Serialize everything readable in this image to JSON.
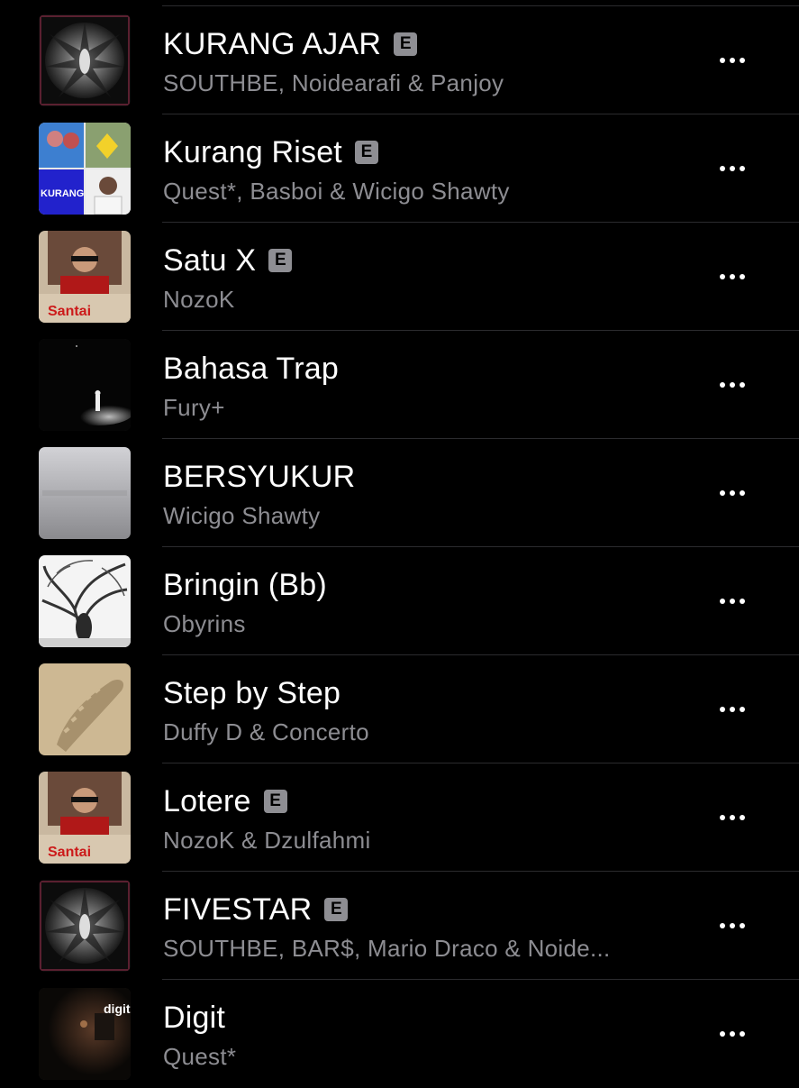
{
  "songs": [
    {
      "title": "KURANG AJAR",
      "explicit": true,
      "explicit_label": "E",
      "artist": "SOUTHBE, Noidearafi & Panjoy",
      "artwork": "symmetric-dark-art"
    },
    {
      "title": "Kurang Riset",
      "explicit": true,
      "explicit_label": "E",
      "artist": "Quest*, Basboi & Wicigo Shawty",
      "artwork": "collage-art"
    },
    {
      "title": "Satu X",
      "explicit": true,
      "explicit_label": "E",
      "artist": "NozoK",
      "artwork": "portrait-red-art"
    },
    {
      "title": "Bahasa Trap",
      "explicit": false,
      "explicit_label": "",
      "artist": "Fury+",
      "artwork": "spotlight-figure-art"
    },
    {
      "title": "BERSYUKUR",
      "explicit": false,
      "explicit_label": "",
      "artist": "Wicigo Shawty",
      "artwork": "grey-gradient-art"
    },
    {
      "title": "Bringin (Bb)",
      "explicit": false,
      "explicit_label": "",
      "artist": "Obyrins",
      "artwork": "tree-sketch-art"
    },
    {
      "title": "Step by Step",
      "explicit": false,
      "explicit_label": "",
      "artist": "Duffy D & Concerto",
      "artwork": "footprint-sand-art"
    },
    {
      "title": "Lotere",
      "explicit": true,
      "explicit_label": "E",
      "artist": "NozoK & Dzulfahmi",
      "artwork": "portrait-red-art"
    },
    {
      "title": "FIVESTAR",
      "explicit": true,
      "explicit_label": "E",
      "artist": "SOUTHBE, BAR$, Mario Draco & Noide...",
      "artwork": "symmetric-dark-art"
    },
    {
      "title": "Digit",
      "explicit": false,
      "explicit_label": "",
      "artist": "Quest*",
      "artwork": "dark-room-art"
    }
  ],
  "colors": {
    "background": "#000000",
    "title_text": "#ffffff",
    "artist_text": "#8d8d92",
    "badge_bg": "#8e8e93",
    "divider": "#2b2b2e"
  },
  "icons": {
    "more": "ellipsis-icon",
    "explicit": "explicit-badge"
  }
}
